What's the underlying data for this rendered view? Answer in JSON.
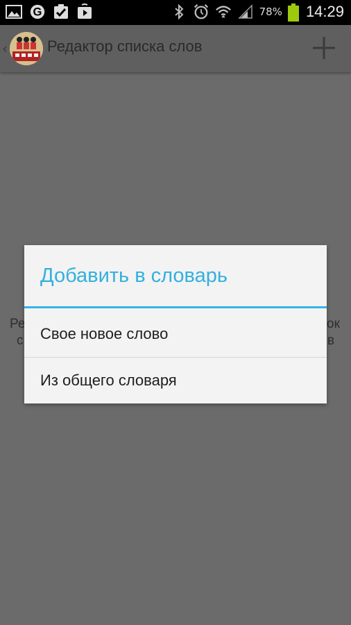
{
  "status_bar": {
    "battery_percent": "78%",
    "time": "14:29",
    "left_icons": [
      "gallery-icon",
      "google-icon",
      "checkbox-icon",
      "play-store-icon"
    ],
    "right_icons": [
      "bluetooth-icon",
      "alarm-icon",
      "wifi-icon",
      "signal-icon",
      "battery-icon"
    ]
  },
  "action_bar": {
    "title": "Редактор списка слов",
    "add_icon": "plus-icon"
  },
  "background_fragments": {
    "left_line1": "Ре",
    "left_line2": "с",
    "right_line1": "ок",
    "right_line2": "в"
  },
  "dialog": {
    "title": "Добавить в словарь",
    "items": [
      {
        "label": "Свое новое слово"
      },
      {
        "label": "Из общего словаря"
      }
    ]
  },
  "colors": {
    "accent": "#33b5e5",
    "scrim": "#6b6b6b",
    "dialog_bg": "#f3f3f3"
  }
}
